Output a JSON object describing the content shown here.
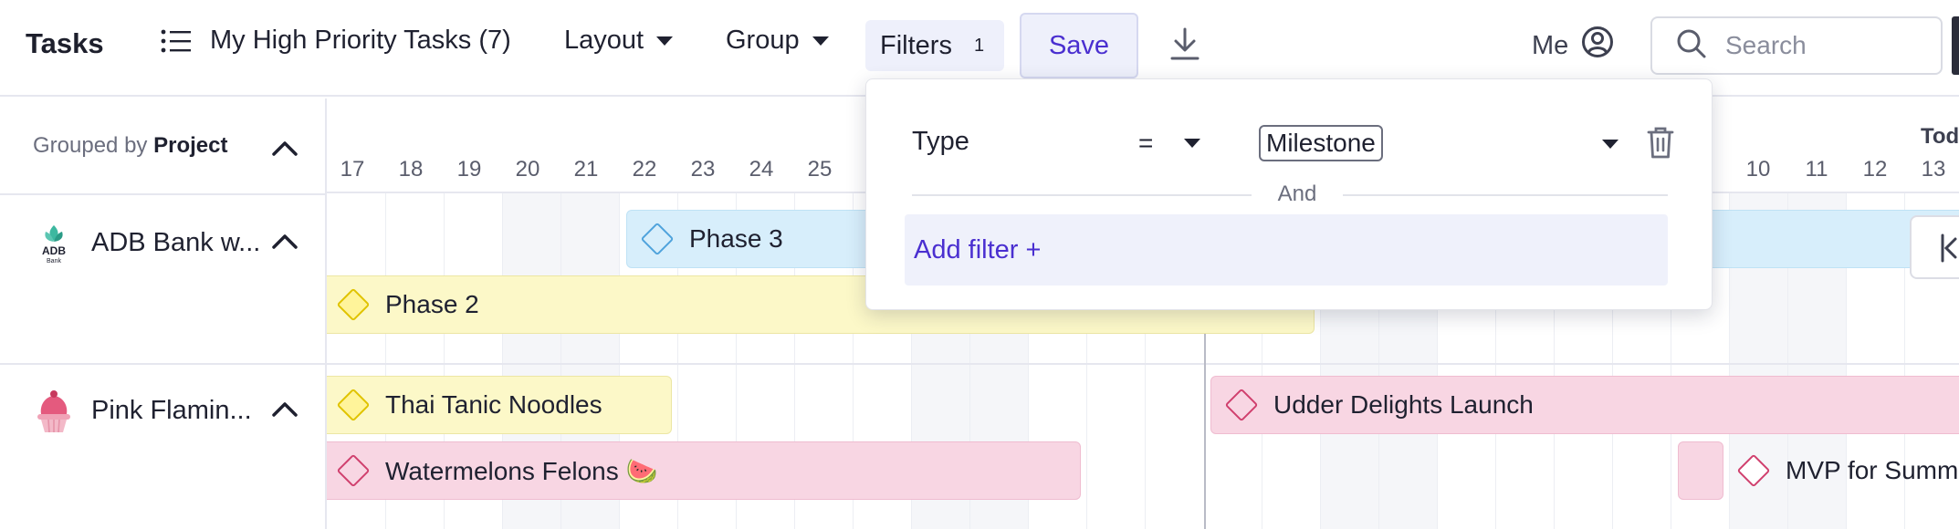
{
  "header": {
    "title": "Tasks",
    "view_name": "My High Priority Tasks (7)",
    "layout_label": "Layout",
    "group_label": "Group",
    "filters_label": "Filters",
    "filters_count": "1",
    "save_label": "Save",
    "me_label": "Me",
    "search_placeholder": "Search"
  },
  "left_panel": {
    "grouped_by_prefix": "Grouped by",
    "grouped_by_value": "Project",
    "groups": [
      {
        "name": "ADB Bank w...",
        "logo_text": "ADB",
        "logo_sub": "Bank"
      },
      {
        "name": "Pink Flamin..."
      }
    ]
  },
  "timeline": {
    "days_left": [
      "17",
      "18",
      "19",
      "20",
      "21",
      "22",
      "23",
      "24",
      "25"
    ],
    "days_right": [
      "10",
      "11",
      "12",
      "13"
    ],
    "today_label": "Tod",
    "bars": {
      "phase3": "Phase 3",
      "phase2": "Phase 2",
      "thai": "Thai Tanic Noodles",
      "udder": "Udder Delights Launch",
      "watermelons": "Watermelons Felons 🍉",
      "mvp": "MVP for Summ"
    }
  },
  "filter_popover": {
    "field": "Type",
    "operator": "=",
    "value": "Milestone",
    "conjunction": "And",
    "add_filter_label": "Add filter +"
  },
  "colors": {
    "accent": "#4a2fd0",
    "bar_blue": "#d7eefb",
    "bar_yellow": "#fcf8c8",
    "bar_pink": "#f8d6e3"
  }
}
